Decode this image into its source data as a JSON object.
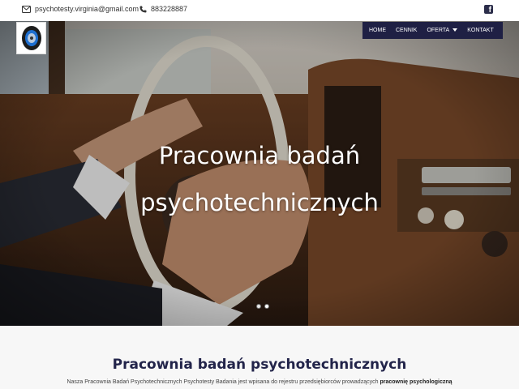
{
  "topbar": {
    "email": "psychotesty.virginia@gmail.com",
    "phone": "883228887",
    "email_icon": "envelope-icon",
    "phone_icon": "phone-icon",
    "social_icon": "facebook-icon"
  },
  "nav": {
    "items": [
      {
        "label": "HOME"
      },
      {
        "label": "CENNIK"
      },
      {
        "label": "OFERTA"
      },
      {
        "label": "KONTAKT"
      }
    ]
  },
  "hero": {
    "title_line1": "Pracownia badań",
    "title_line2": "psychotechnicznych",
    "slides_count": 2,
    "active_slide": 1
  },
  "section": {
    "title": "Pracownia badań psychotechnicznych",
    "text": "Nasza Pracownia Badań Psychotechnicznych Psychotesty Badania jest wpisana do rejestru przedsiębiorców prowadzących",
    "text_bold": "pracownię psychologiczną"
  },
  "colors": {
    "nav_bg": "#1f2044",
    "title_color": "#22244a",
    "section_bg": "#f7f7f7"
  }
}
